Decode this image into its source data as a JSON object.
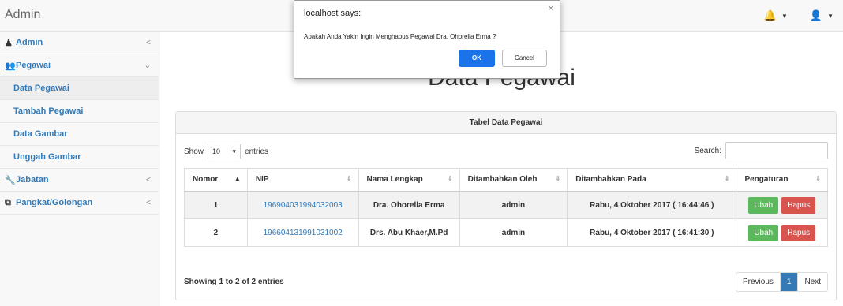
{
  "app": {
    "title": "Admin"
  },
  "topbar": {
    "bell_icon": "bell-icon",
    "user_icon": "user-icon"
  },
  "sidebar": {
    "items": [
      {
        "label": "Admin",
        "icon": "user-icon",
        "chevron": "<"
      },
      {
        "label": "Pegawai",
        "icon": "users-icon",
        "chevron": "⌄"
      },
      {
        "label": "Jabatan",
        "icon": "wrench-icon",
        "chevron": "<"
      },
      {
        "label": "Pangkat/Golongan",
        "icon": "sitemap-icon",
        "chevron": "<"
      }
    ],
    "sub_items": [
      {
        "label": "Data Pegawai"
      },
      {
        "label": "Tambah Pegawai"
      },
      {
        "label": "Data Gambar"
      },
      {
        "label": "Unggah Gambar"
      }
    ]
  },
  "main": {
    "title": "Data Pegawai",
    "panel_title": "Tabel Data Pegawai",
    "show_label": "Show",
    "entries_value": "10",
    "entries_label": "entries",
    "search_label": "Search:",
    "search_value": "",
    "columns": [
      "Nomor",
      "NIP",
      "Nama Lengkap",
      "Ditambahkan Oleh",
      "Ditambahkan Pada",
      "Pengaturan"
    ],
    "rows": [
      {
        "no": "1",
        "nip": "196904031994032003",
        "nama": "Dra. Ohorella Erma",
        "oleh": "admin",
        "pada": "Rabu, 4 Oktober 2017 ( 16:44:46 )"
      },
      {
        "no": "2",
        "nip": "196604131991031002",
        "nama": "Drs. Abu Khaer,M.Pd",
        "oleh": "admin",
        "pada": "Rabu, 4 Oktober 2017 ( 16:41:30 )"
      }
    ],
    "edit_label": "Ubah",
    "delete_label": "Hapus",
    "info_text": "Showing 1 to 2 of 2 entries",
    "pager": {
      "prev": "Previous",
      "current": "1",
      "next": "Next"
    }
  },
  "dialog": {
    "title": "localhost says:",
    "close": "×",
    "message": "Apakah Anda Yakin Ingin Menghapus Pegawai Dra. Ohorella Erma ?",
    "ok_label": "OK",
    "cancel_label": "Cancel"
  },
  "colors": {
    "link": "#337ab7",
    "edit": "#5cb85c",
    "delete": "#d9534f",
    "dialog_ok": "#1a73e8"
  }
}
